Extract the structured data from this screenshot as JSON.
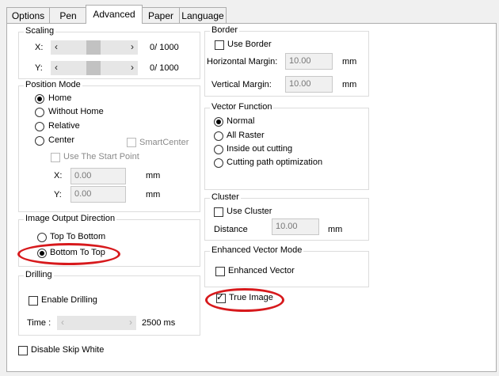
{
  "tabs": [
    "Options",
    "Pen",
    "Advanced",
    "Paper",
    "Language"
  ],
  "scaling": {
    "title": "Scaling",
    "x_label": "X:",
    "x_value": "0/ 1000",
    "y_label": "Y:",
    "y_value": "0/ 1000"
  },
  "position_mode": {
    "title": "Position Mode",
    "options": [
      "Home",
      "Without Home",
      "Relative",
      "Center"
    ],
    "selected": "Home",
    "smart_center": "SmartCenter",
    "use_start_point": "Use The Start Point",
    "x_label": "X:",
    "x_value": "0.00",
    "x_unit": "mm",
    "y_label": "Y:",
    "y_value": "0.00",
    "y_unit": "mm"
  },
  "image_output": {
    "title": "Image Output Direction",
    "options": [
      "Top To Bottom",
      "Bottom To Top"
    ],
    "selected": "Bottom To Top"
  },
  "drilling": {
    "title": "Drilling",
    "enable_label": "Enable Drilling",
    "time_label": "Time :",
    "time_value": "2500 ms"
  },
  "disable_skip_white": "Disable Skip White",
  "border": {
    "title": "Border",
    "use_border": "Use Border",
    "h_margin_label": "Horizontal Margin:",
    "h_margin_value": "10.00",
    "h_unit": "mm",
    "v_margin_label": "Vertical Margin:",
    "v_margin_value": "10.00",
    "v_unit": "mm"
  },
  "vector_function": {
    "title": "Vector Function",
    "options": [
      "Normal",
      "All Raster",
      "Inside out cutting",
      "Cutting path optimization"
    ],
    "selected": "Normal"
  },
  "cluster": {
    "title": "Cluster",
    "use_cluster": "Use Cluster",
    "distance_label": "Distance",
    "distance_value": "10.00",
    "distance_unit": "mm"
  },
  "enhanced_vector_mode": {
    "title": "Enhanced Vector Mode",
    "enhanced_vector": "Enhanced Vector"
  },
  "true_image": {
    "label": "True Image",
    "checked": true
  },
  "annotation_color": "#d7191c"
}
